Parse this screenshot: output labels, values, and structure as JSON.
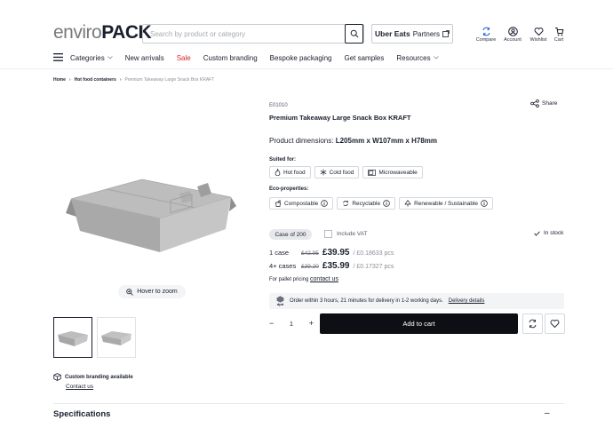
{
  "header": {
    "logo_part1": "enviro",
    "logo_part2": "PACK",
    "search_placeholder": "Search by product or category",
    "uber_brand": "Uber Eats",
    "uber_label": "Partners",
    "icons": [
      {
        "label": "Compare",
        "icon": "compare-icon"
      },
      {
        "label": "Account",
        "icon": "account-icon"
      },
      {
        "label": "Wishlist",
        "icon": "heart-icon"
      },
      {
        "label": "Cart",
        "icon": "cart-icon"
      }
    ]
  },
  "nav": {
    "categories": "Categories",
    "new_arrivals": "New arrivals",
    "sale": "Sale",
    "custom_branding": "Custom branding",
    "bespoke": "Bespoke packaging",
    "samples": "Get samples",
    "resources": "Resources"
  },
  "breadcrumb": {
    "home": "Home",
    "category": "Hot food containers",
    "current": "Premium Takeaway Large Snack Box KRAFT"
  },
  "gallery": {
    "zoom_label": "Hover to zoom"
  },
  "branding": {
    "title": "Custom branding available",
    "link": "Contact us"
  },
  "product": {
    "sku": "E01010",
    "title": "Premium Takeaway Large Snack Box KRAFT",
    "share": "Share",
    "dims_label": "Product dimensions:",
    "dims_value": "L205mm x W107mm x H78mm",
    "suited_label": "Suited for:",
    "suited": [
      "Hot food",
      "Cold food",
      "Microwaveable"
    ],
    "eco_label": "Eco-properties:",
    "eco": [
      "Compostable",
      "Recyclable",
      "Renewable / Sustainable"
    ],
    "case_size": "Case of 200",
    "include_vat": "Include VAT",
    "stock": "In stock",
    "prices": [
      {
        "qty": "1 case",
        "old": "£42.95",
        "now": "£39.95",
        "per": "/ £0.18633 pcs"
      },
      {
        "qty": "4+ cases",
        "old": "£39.20",
        "now": "£35.99",
        "per": "/ £0.17327 pcs"
      }
    ],
    "pallet_text": "For pallet pricing",
    "pallet_link": "contact us",
    "delivery_carrier": "dpd",
    "delivery_text": "Order within 3 hours, 21 minutes for delivery in 1-2 working days.",
    "delivery_link": "Delivery details",
    "quantity": "1",
    "minus": "−",
    "plus": "+",
    "add_to_cart": "Add to cart"
  },
  "specs": {
    "title": "Specifications",
    "toggle": "–"
  },
  "colors": {
    "accent": "#0d0f14",
    "sale": "#d9262c",
    "muted": "#8a8e98"
  }
}
